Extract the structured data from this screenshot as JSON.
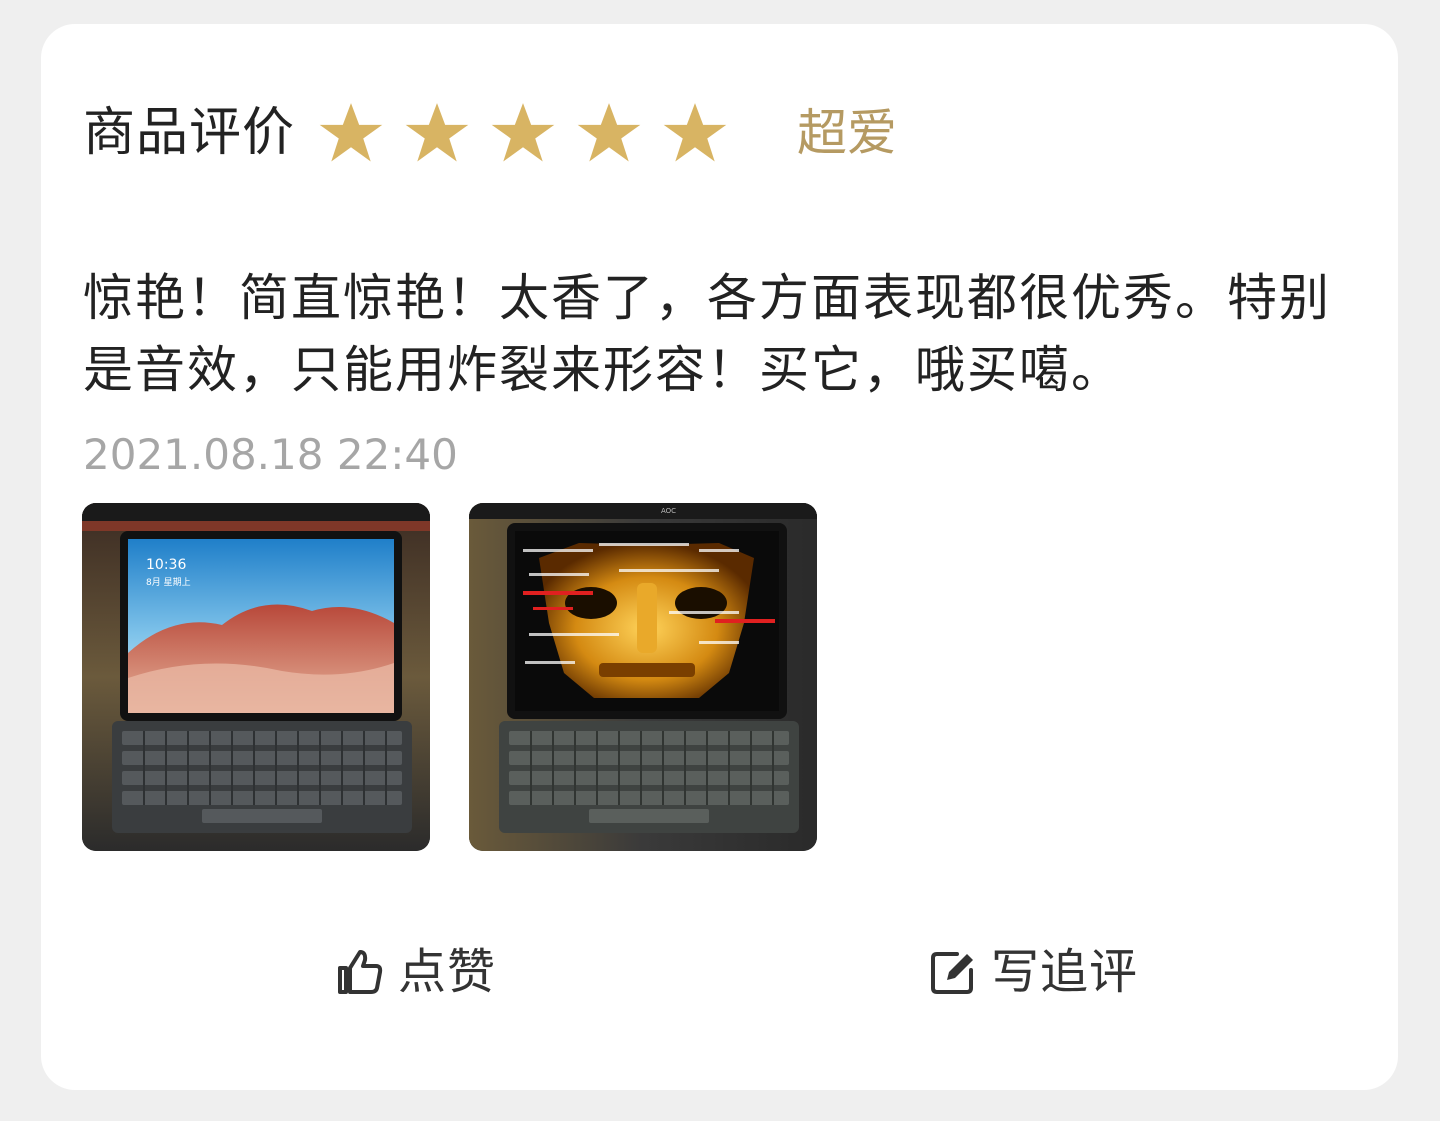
{
  "review": {
    "title": "商品评价",
    "stars": {
      "count": 5,
      "filled": 5,
      "color": "#d8b463"
    },
    "rating_label": "超爱",
    "rating_label_color": "#b59a62",
    "text": "惊艳！简直惊艳！太香了，各方面表现都很优秀。特别是音效，只能用炸裂来形容！买它，哦买噶。",
    "timestamp": "2021.08.18 22:40",
    "photos": [
      {
        "screen_text_time": "10:36",
        "screen_text_date": "8月 星期上"
      },
      {
        "logo_text": "AOC"
      }
    ]
  },
  "actions": {
    "like_label": "点赞",
    "like_icon": "thumbs-up-icon",
    "comment_label": "写追评",
    "comment_icon": "edit-icon"
  }
}
